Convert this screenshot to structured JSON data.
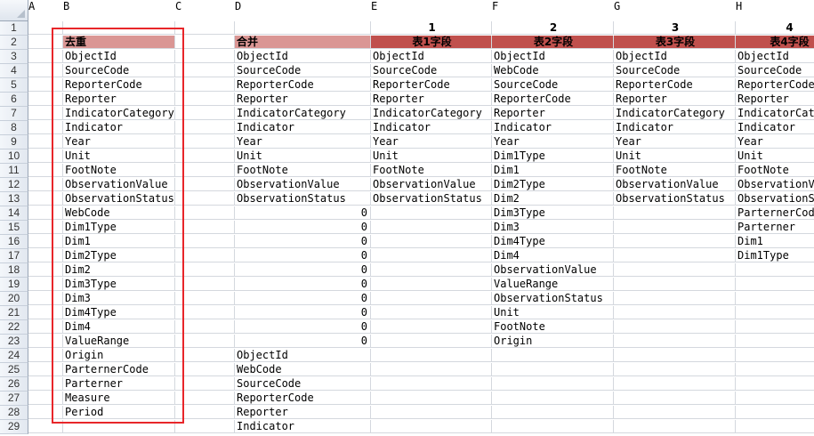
{
  "columns": [
    "A",
    "B",
    "C",
    "D",
    "E",
    "F",
    "G",
    "H"
  ],
  "selected_column": "F",
  "rows": [
    1,
    2,
    3,
    4,
    5,
    6,
    7,
    8,
    9,
    10,
    11,
    12,
    13,
    14,
    15,
    16,
    17,
    18,
    19,
    20,
    21,
    22,
    23,
    24,
    25,
    26,
    27,
    28,
    29
  ],
  "row1": {
    "E": "1",
    "F": "2",
    "G": "3",
    "H": "4"
  },
  "row2": {
    "B": "去重",
    "D": "合并",
    "E": "表1字段",
    "F": "表2字段",
    "G": "表3字段",
    "H": "表4字段"
  },
  "colB": [
    "ObjectId",
    "SourceCode",
    "ReporterCode",
    "Reporter",
    "IndicatorCategory",
    "Indicator",
    "Year",
    "Unit",
    "FootNote",
    "ObservationValue",
    "ObservationStatus",
    "WebCode",
    "Dim1Type",
    "Dim1",
    "Dim2Type",
    "Dim2",
    "Dim3Type",
    "Dim3",
    "Dim4Type",
    "Dim4",
    "ValueRange",
    "Origin",
    "ParternerCode",
    "Parterner",
    "Measure",
    "Period"
  ],
  "colD": [
    "ObjectId",
    "SourceCode",
    "ReporterCode",
    "Reporter",
    "IndicatorCategory",
    "Indicator",
    "Year",
    "Unit",
    "FootNote",
    "ObservationValue",
    "ObservationStatus",
    "0",
    "0",
    "0",
    "0",
    "0",
    "0",
    "0",
    "0",
    "0",
    "0",
    "ObjectId",
    "WebCode",
    "SourceCode",
    "ReporterCode",
    "Reporter",
    "Indicator"
  ],
  "colE": [
    "ObjectId",
    "SourceCode",
    "ReporterCode",
    "Reporter",
    "IndicatorCategory",
    "Indicator",
    "Year",
    "Unit",
    "FootNote",
    "ObservationValue",
    "ObservationStatus"
  ],
  "colF": [
    "ObjectId",
    "WebCode",
    "SourceCode",
    "ReporterCode",
    "Reporter",
    "Indicator",
    "Year",
    "Dim1Type",
    "Dim1",
    "Dim2Type",
    "Dim2",
    "Dim3Type",
    "Dim3",
    "Dim4Type",
    "Dim4",
    "ObservationValue",
    "ValueRange",
    "ObservationStatus",
    "Unit",
    "FootNote",
    "Origin"
  ],
  "colG": [
    "ObjectId",
    "SourceCode",
    "ReporterCode",
    "Reporter",
    "IndicatorCategory",
    "Indicator",
    "Year",
    "Unit",
    "FootNote",
    "ObservationValue",
    "ObservationStatus"
  ],
  "colH": [
    "ObjectId",
    "SourceCode",
    "ReporterCode",
    "Reporter",
    "IndicatorCat",
    "Indicator",
    "Year",
    "Unit",
    "FootNote",
    "ObservationV",
    "ObservationSt",
    "ParternerCod",
    "Parterner",
    "Dim1",
    "Dim1Type"
  ],
  "colors": {
    "header_pink": "#da9694",
    "header_red": "#c0504d",
    "highlight_box": "#e8262a",
    "selected_column": "#f7c94f"
  }
}
